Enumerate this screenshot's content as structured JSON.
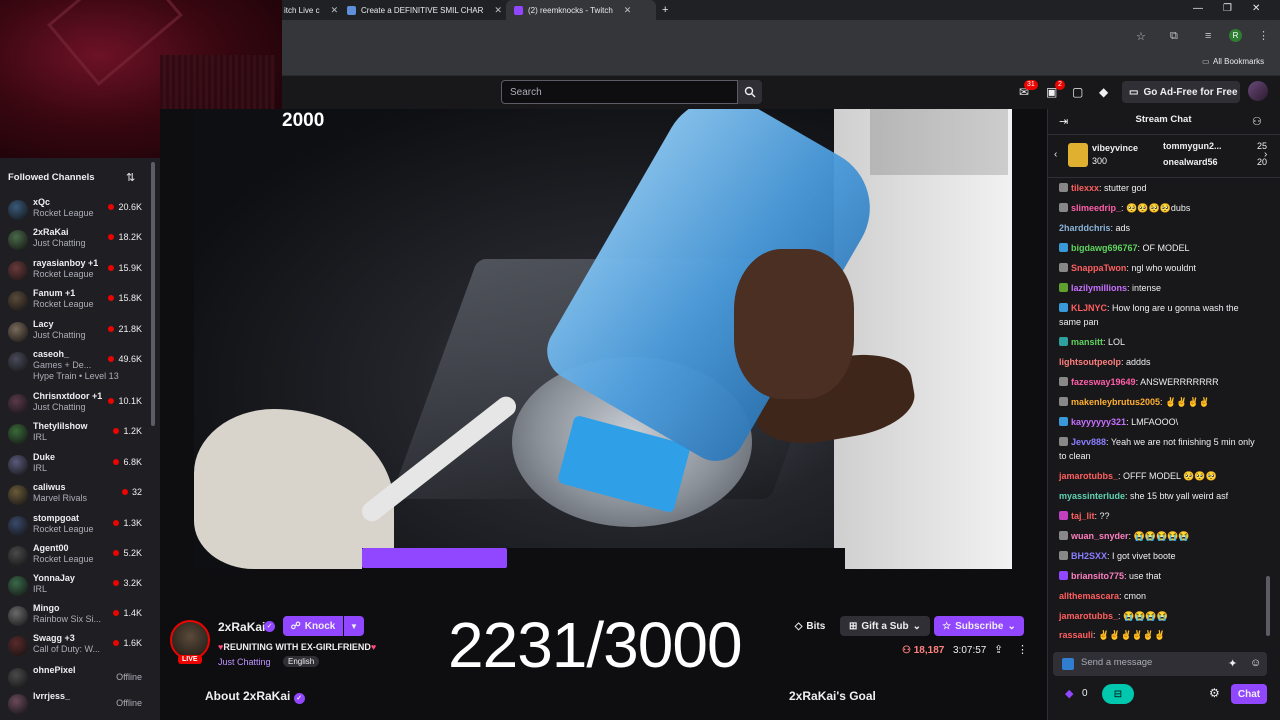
{
  "browser": {
    "tabs": [
      {
        "label": "itch Live c"
      },
      {
        "label": "Create a DEFINITIVE SMIL CHAR"
      },
      {
        "label": "(2) reemknocks - Twitch"
      }
    ],
    "new_tab": "+",
    "all_bookmarks": "All Bookmarks",
    "profile_letter": "R"
  },
  "topnav": {
    "search_placeholder": "Search",
    "inbox_badge": "31",
    "notif_badge": "2",
    "adfree_label": "Go Ad-Free for Free"
  },
  "overlay": {
    "top_counter": "2000",
    "big_counter": "2231/3000",
    "progress": 0.3
  },
  "sidebar": {
    "heading": "Followed Channels",
    "channels": [
      {
        "name": "xQc",
        "game": "Rocket League",
        "viewers": "20.6K",
        "color": "#3a5a7a"
      },
      {
        "name": "2xRaKai",
        "game": "Just Chatting",
        "viewers": "18.2K",
        "color": "#4a6a4a"
      },
      {
        "name": "rayasianboy +1",
        "game": "Rocket League",
        "viewers": "15.9K",
        "color": "#6a3a3a"
      },
      {
        "name": "Fanum +1",
        "game": "Rocket League",
        "viewers": "15.8K",
        "color": "#5a4a3a"
      },
      {
        "name": "Lacy",
        "game": "Just Chatting",
        "viewers": "21.8K",
        "color": "#7a6a5a"
      },
      {
        "name": "caseoh_",
        "game": "Games + De...",
        "extra": "Hype Train • Level 13",
        "viewers": "49.6K",
        "color": "#4a4a5a"
      },
      {
        "name": "Chrisnxtdoor +1",
        "game": "Just Chatting",
        "viewers": "10.1K",
        "color": "#5a3a4a"
      },
      {
        "name": "Thetylilshow",
        "game": "IRL",
        "viewers": "1.2K",
        "color": "#3a6a3a"
      },
      {
        "name": "Duke",
        "game": "IRL",
        "viewers": "6.8K",
        "color": "#5a5a7a"
      },
      {
        "name": "caliwus",
        "game": "Marvel Rivals",
        "viewers": "32",
        "color": "#6a5a3a"
      },
      {
        "name": "stompgoat",
        "game": "Rocket League",
        "viewers": "1.3K",
        "color": "#3a4a6a"
      },
      {
        "name": "Agent00",
        "game": "Rocket League",
        "viewers": "5.2K",
        "color": "#4a4a4a"
      },
      {
        "name": "YonnaJay",
        "game": "IRL",
        "viewers": "3.2K",
        "color": "#3a6a4a"
      },
      {
        "name": "Mingo",
        "game": "Rainbow Six Si...",
        "viewers": "1.4K",
        "color": "#6a6a6a"
      },
      {
        "name": "Swagg +3",
        "game": "Call of Duty: W...",
        "viewers": "1.6K",
        "color": "#5a2a2a"
      },
      {
        "name": "ohnePixel",
        "offline": "Offline",
        "color": "#4a4a4a"
      },
      {
        "name": "lvrrjess_",
        "offline": "Offline",
        "color": "#6a4a5a"
      }
    ]
  },
  "stream": {
    "streamer": "2xRaKai",
    "live": "LIVE",
    "knock": "Knock",
    "title": "REUNITING WITH EX-GIRLFRIEND",
    "category": "Just Chatting",
    "language": "English",
    "bits": "Bits",
    "gift": "Gift a Sub",
    "subscribe": "Subscribe",
    "viewers": "18,187",
    "uptime": "3:07:57",
    "about": "About 2xRaKai",
    "goal": "2xRaKai's Goal"
  },
  "chat": {
    "heading": "Stream Chat",
    "hype": [
      {
        "user": "vibeyvince",
        "count": "300"
      },
      {
        "user": "tommygun2...",
        "count": "25"
      },
      {
        "user": "onealward56",
        "count": "20"
      }
    ],
    "messages": [
      {
        "user": "tilexxx",
        "text": ": stutter god",
        "color": "#ff5f5f",
        "badge": "#888"
      },
      {
        "user": "slimeedrip_",
        "text": ": 🥺🥺🥺🥺dubs",
        "color": "#ff5fa8",
        "badge": "#888"
      },
      {
        "user": "2harddchris",
        "text": ": ads",
        "color": "#8ab4d9"
      },
      {
        "user": "bigdawg696767",
        "text": ": OF MODEL",
        "color": "#5fd35f",
        "badge": "#3a9ad9"
      },
      {
        "user": "SnappaTwon",
        "text": ": ngl who wouldnt",
        "color": "#ff5f5f",
        "badge": "#888"
      },
      {
        "user": "lazilymillions",
        "text": ": intense",
        "color": "#c770ff",
        "badge": "#5fa02f"
      },
      {
        "user": "KLJNYC",
        "text": ": How long are u gonna wash the same pan",
        "color": "#ff5f5f",
        "badge": "#3a9ad9"
      },
      {
        "user": "mansitt",
        "text": ": LOL",
        "color": "#5fd35f",
        "badge": "#2fa0a0"
      },
      {
        "user": "lightsoutpeolp",
        "text": ": addds",
        "color": "#ff7f7f"
      },
      {
        "user": "fazesway19649",
        "text": ": ANSWERRRRRRR",
        "color": "#ff5fa8",
        "badge": "#888"
      },
      {
        "user": "makenleybrutus2005",
        "text": ": ✌️✌️✌️✌️",
        "color": "#ffb030",
        "badge": "#888"
      },
      {
        "user": "kayyyyyy321",
        "text": ": LMFAOOO\\",
        "color": "#c770ff",
        "badge": "#3a9ad9"
      },
      {
        "user": "Jevv888",
        "text": ": Yeah we are not finishing 5 min only to clean",
        "color": "#8a7fff",
        "badge": "#888"
      },
      {
        "user": "jamarotubbs_",
        "text": ": OFFF MODEL 🥺🥺🥺",
        "color": "#ff5f5f"
      },
      {
        "user": "myassinterlude",
        "text": ": she 15 btw yall weird asf",
        "color": "#5fd3b0"
      },
      {
        "user": "taj_lit",
        "text": ": ??",
        "color": "#ff5f5f",
        "badge": "#c040c0"
      },
      {
        "user": "wuan_snyder",
        "text": ": 😭😭😭😭😭",
        "color": "#ff7fc0",
        "badge": "#888"
      },
      {
        "user": "BH2SXX",
        "text": ": I got vivet boote",
        "color": "#8a7fff",
        "badge": "#888"
      },
      {
        "user": "briansito775",
        "text": ": use that",
        "color": "#ff7fc0",
        "badge": "#9146ff"
      },
      {
        "user": "allthemascara",
        "text": ": cmon",
        "color": "#ff5f5f"
      },
      {
        "user": "jamarotubbs_",
        "text": ": 😭😭😭😭",
        "color": "#ff5f5f"
      },
      {
        "user": "rassauli",
        "text": ": ✌️✌️✌️✌️✌️✌️",
        "color": "#ff5f5f"
      }
    ],
    "input_placeholder": "Send a message",
    "points": "0",
    "chat_button": "Chat"
  }
}
